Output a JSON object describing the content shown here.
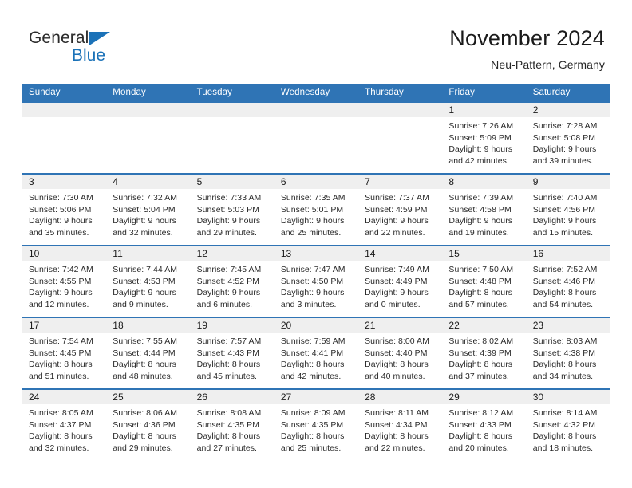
{
  "logo": {
    "text_primary": "General",
    "text_secondary": "Blue",
    "triangle_icon": "logo-triangle-icon",
    "primary_color": "#2b2b2b",
    "accent_color": "#1b72b8"
  },
  "header": {
    "title": "November 2024",
    "subtitle": "Neu-Pattern, Germany"
  },
  "theme": {
    "header_blue": "#2f74b5",
    "row_band_gray": "#efefef",
    "text_color": "#2a2a2a"
  },
  "calendar": {
    "weekday_headers": [
      "Sunday",
      "Monday",
      "Tuesday",
      "Wednesday",
      "Thursday",
      "Friday",
      "Saturday"
    ],
    "weeks": [
      [
        {
          "day": "",
          "sunrise": "",
          "sunset": "",
          "daylight_line1": "",
          "daylight_line2": "",
          "empty": true
        },
        {
          "day": "",
          "sunrise": "",
          "sunset": "",
          "daylight_line1": "",
          "daylight_line2": "",
          "empty": true
        },
        {
          "day": "",
          "sunrise": "",
          "sunset": "",
          "daylight_line1": "",
          "daylight_line2": "",
          "empty": true
        },
        {
          "day": "",
          "sunrise": "",
          "sunset": "",
          "daylight_line1": "",
          "daylight_line2": "",
          "empty": true
        },
        {
          "day": "",
          "sunrise": "",
          "sunset": "",
          "daylight_line1": "",
          "daylight_line2": "",
          "empty": true
        },
        {
          "day": "1",
          "sunrise": "Sunrise: 7:26 AM",
          "sunset": "Sunset: 5:09 PM",
          "daylight_line1": "Daylight: 9 hours",
          "daylight_line2": "and 42 minutes.",
          "empty": false
        },
        {
          "day": "2",
          "sunrise": "Sunrise: 7:28 AM",
          "sunset": "Sunset: 5:08 PM",
          "daylight_line1": "Daylight: 9 hours",
          "daylight_line2": "and 39 minutes.",
          "empty": false
        }
      ],
      [
        {
          "day": "3",
          "sunrise": "Sunrise: 7:30 AM",
          "sunset": "Sunset: 5:06 PM",
          "daylight_line1": "Daylight: 9 hours",
          "daylight_line2": "and 35 minutes.",
          "empty": false
        },
        {
          "day": "4",
          "sunrise": "Sunrise: 7:32 AM",
          "sunset": "Sunset: 5:04 PM",
          "daylight_line1": "Daylight: 9 hours",
          "daylight_line2": "and 32 minutes.",
          "empty": false
        },
        {
          "day": "5",
          "sunrise": "Sunrise: 7:33 AM",
          "sunset": "Sunset: 5:03 PM",
          "daylight_line1": "Daylight: 9 hours",
          "daylight_line2": "and 29 minutes.",
          "empty": false
        },
        {
          "day": "6",
          "sunrise": "Sunrise: 7:35 AM",
          "sunset": "Sunset: 5:01 PM",
          "daylight_line1": "Daylight: 9 hours",
          "daylight_line2": "and 25 minutes.",
          "empty": false
        },
        {
          "day": "7",
          "sunrise": "Sunrise: 7:37 AM",
          "sunset": "Sunset: 4:59 PM",
          "daylight_line1": "Daylight: 9 hours",
          "daylight_line2": "and 22 minutes.",
          "empty": false
        },
        {
          "day": "8",
          "sunrise": "Sunrise: 7:39 AM",
          "sunset": "Sunset: 4:58 PM",
          "daylight_line1": "Daylight: 9 hours",
          "daylight_line2": "and 19 minutes.",
          "empty": false
        },
        {
          "day": "9",
          "sunrise": "Sunrise: 7:40 AM",
          "sunset": "Sunset: 4:56 PM",
          "daylight_line1": "Daylight: 9 hours",
          "daylight_line2": "and 15 minutes.",
          "empty": false
        }
      ],
      [
        {
          "day": "10",
          "sunrise": "Sunrise: 7:42 AM",
          "sunset": "Sunset: 4:55 PM",
          "daylight_line1": "Daylight: 9 hours",
          "daylight_line2": "and 12 minutes.",
          "empty": false
        },
        {
          "day": "11",
          "sunrise": "Sunrise: 7:44 AM",
          "sunset": "Sunset: 4:53 PM",
          "daylight_line1": "Daylight: 9 hours",
          "daylight_line2": "and 9 minutes.",
          "empty": false
        },
        {
          "day": "12",
          "sunrise": "Sunrise: 7:45 AM",
          "sunset": "Sunset: 4:52 PM",
          "daylight_line1": "Daylight: 9 hours",
          "daylight_line2": "and 6 minutes.",
          "empty": false
        },
        {
          "day": "13",
          "sunrise": "Sunrise: 7:47 AM",
          "sunset": "Sunset: 4:50 PM",
          "daylight_line1": "Daylight: 9 hours",
          "daylight_line2": "and 3 minutes.",
          "empty": false
        },
        {
          "day": "14",
          "sunrise": "Sunrise: 7:49 AM",
          "sunset": "Sunset: 4:49 PM",
          "daylight_line1": "Daylight: 9 hours",
          "daylight_line2": "and 0 minutes.",
          "empty": false
        },
        {
          "day": "15",
          "sunrise": "Sunrise: 7:50 AM",
          "sunset": "Sunset: 4:48 PM",
          "daylight_line1": "Daylight: 8 hours",
          "daylight_line2": "and 57 minutes.",
          "empty": false
        },
        {
          "day": "16",
          "sunrise": "Sunrise: 7:52 AM",
          "sunset": "Sunset: 4:46 PM",
          "daylight_line1": "Daylight: 8 hours",
          "daylight_line2": "and 54 minutes.",
          "empty": false
        }
      ],
      [
        {
          "day": "17",
          "sunrise": "Sunrise: 7:54 AM",
          "sunset": "Sunset: 4:45 PM",
          "daylight_line1": "Daylight: 8 hours",
          "daylight_line2": "and 51 minutes.",
          "empty": false
        },
        {
          "day": "18",
          "sunrise": "Sunrise: 7:55 AM",
          "sunset": "Sunset: 4:44 PM",
          "daylight_line1": "Daylight: 8 hours",
          "daylight_line2": "and 48 minutes.",
          "empty": false
        },
        {
          "day": "19",
          "sunrise": "Sunrise: 7:57 AM",
          "sunset": "Sunset: 4:43 PM",
          "daylight_line1": "Daylight: 8 hours",
          "daylight_line2": "and 45 minutes.",
          "empty": false
        },
        {
          "day": "20",
          "sunrise": "Sunrise: 7:59 AM",
          "sunset": "Sunset: 4:41 PM",
          "daylight_line1": "Daylight: 8 hours",
          "daylight_line2": "and 42 minutes.",
          "empty": false
        },
        {
          "day": "21",
          "sunrise": "Sunrise: 8:00 AM",
          "sunset": "Sunset: 4:40 PM",
          "daylight_line1": "Daylight: 8 hours",
          "daylight_line2": "and 40 minutes.",
          "empty": false
        },
        {
          "day": "22",
          "sunrise": "Sunrise: 8:02 AM",
          "sunset": "Sunset: 4:39 PM",
          "daylight_line1": "Daylight: 8 hours",
          "daylight_line2": "and 37 minutes.",
          "empty": false
        },
        {
          "day": "23",
          "sunrise": "Sunrise: 8:03 AM",
          "sunset": "Sunset: 4:38 PM",
          "daylight_line1": "Daylight: 8 hours",
          "daylight_line2": "and 34 minutes.",
          "empty": false
        }
      ],
      [
        {
          "day": "24",
          "sunrise": "Sunrise: 8:05 AM",
          "sunset": "Sunset: 4:37 PM",
          "daylight_line1": "Daylight: 8 hours",
          "daylight_line2": "and 32 minutes.",
          "empty": false
        },
        {
          "day": "25",
          "sunrise": "Sunrise: 8:06 AM",
          "sunset": "Sunset: 4:36 PM",
          "daylight_line1": "Daylight: 8 hours",
          "daylight_line2": "and 29 minutes.",
          "empty": false
        },
        {
          "day": "26",
          "sunrise": "Sunrise: 8:08 AM",
          "sunset": "Sunset: 4:35 PM",
          "daylight_line1": "Daylight: 8 hours",
          "daylight_line2": "and 27 minutes.",
          "empty": false
        },
        {
          "day": "27",
          "sunrise": "Sunrise: 8:09 AM",
          "sunset": "Sunset: 4:35 PM",
          "daylight_line1": "Daylight: 8 hours",
          "daylight_line2": "and 25 minutes.",
          "empty": false
        },
        {
          "day": "28",
          "sunrise": "Sunrise: 8:11 AM",
          "sunset": "Sunset: 4:34 PM",
          "daylight_line1": "Daylight: 8 hours",
          "daylight_line2": "and 22 minutes.",
          "empty": false
        },
        {
          "day": "29",
          "sunrise": "Sunrise: 8:12 AM",
          "sunset": "Sunset: 4:33 PM",
          "daylight_line1": "Daylight: 8 hours",
          "daylight_line2": "and 20 minutes.",
          "empty": false
        },
        {
          "day": "30",
          "sunrise": "Sunrise: 8:14 AM",
          "sunset": "Sunset: 4:32 PM",
          "daylight_line1": "Daylight: 8 hours",
          "daylight_line2": "and 18 minutes.",
          "empty": false
        }
      ]
    ]
  }
}
